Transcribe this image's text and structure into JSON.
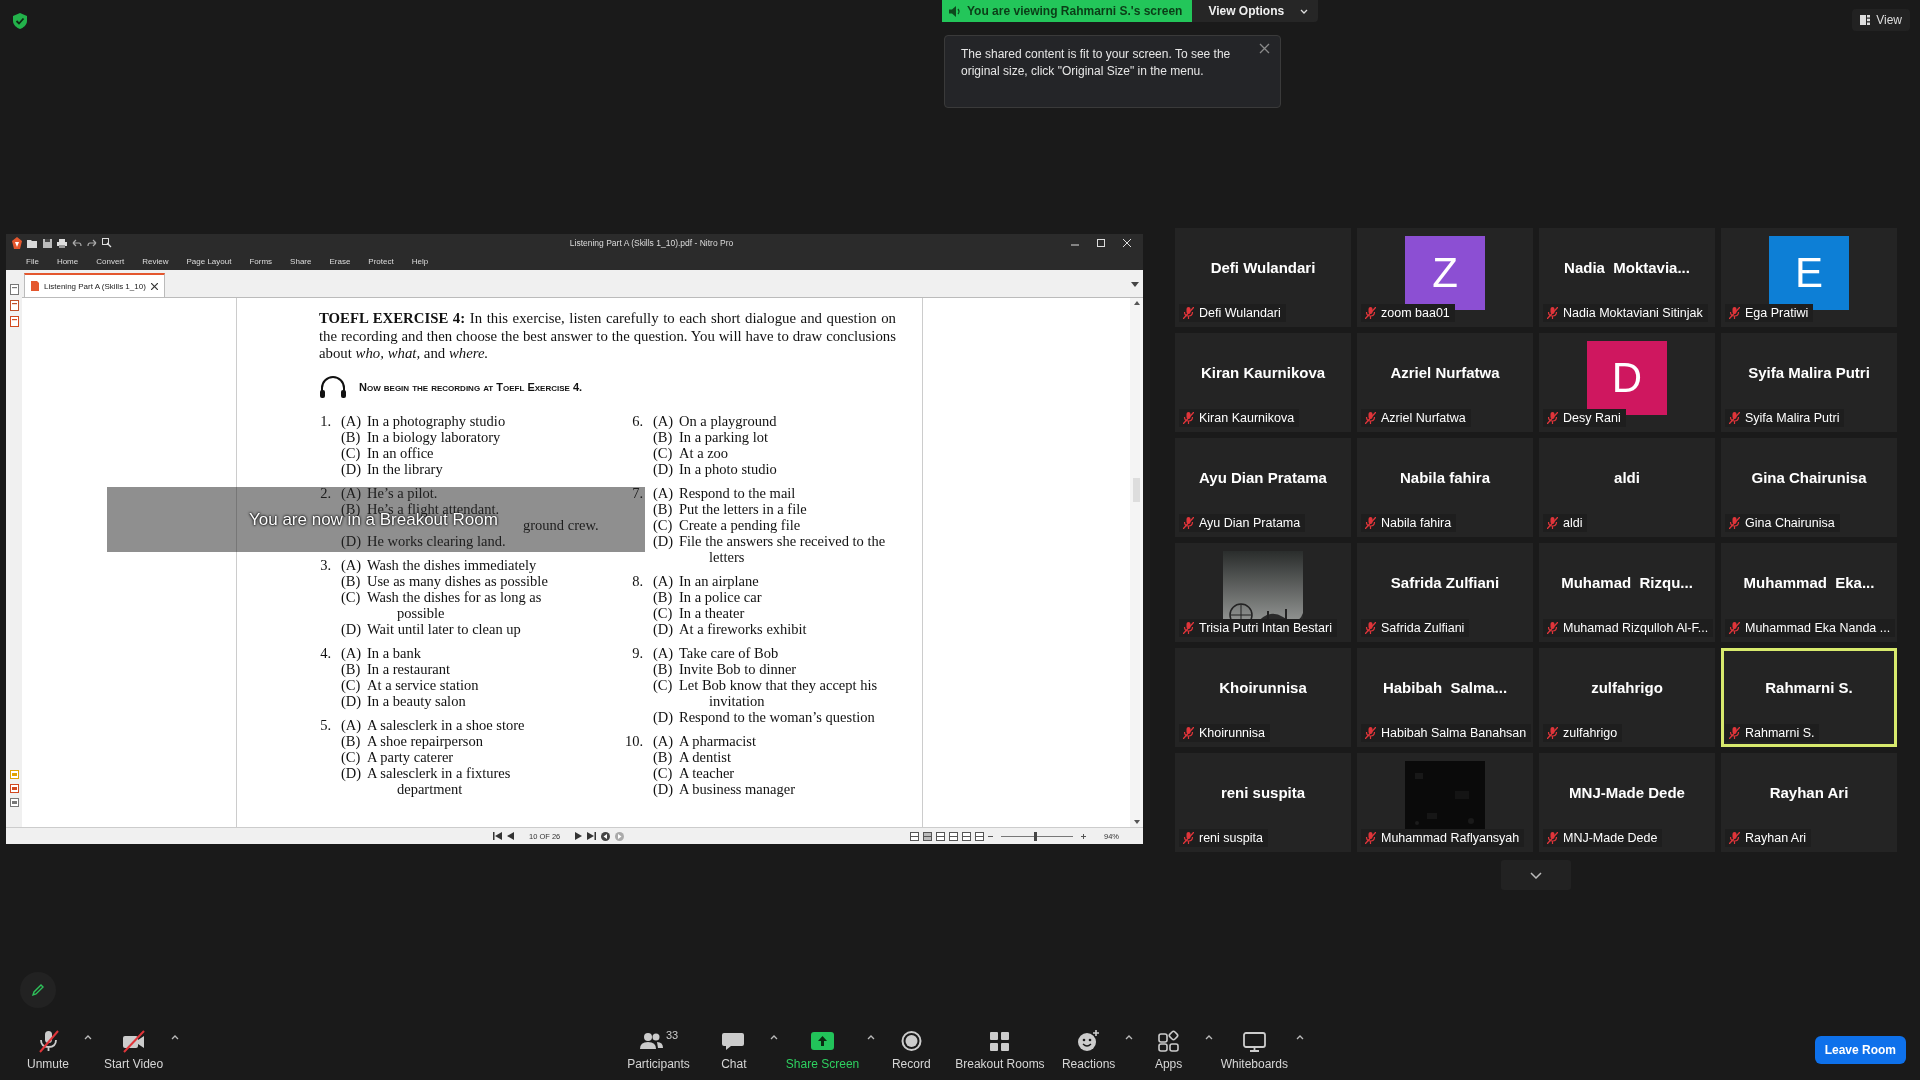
{
  "top_bar": {
    "sharing_banner": "You are viewing Rahmarni S.'s screen",
    "view_options": "View Options",
    "tooltip": "The shared content is fit to your screen. To see the original size, click \"Original Size\" in the menu.",
    "view_button": "View"
  },
  "pdf_window": {
    "title": "Listening Part A (Skills 1_10).pdf - Nitro Pro",
    "menu": [
      "File",
      "Home",
      "Convert",
      "Review",
      "Page Layout",
      "Forms",
      "Share",
      "Erase",
      "Protect",
      "Help"
    ],
    "tabs": [
      {
        "label": "Listening Part A (Skills 1_10)",
        "selected": true
      }
    ],
    "heading": "**TOEFL EXERCISE 4:**  In this exercise, listen carefully to each short dialogue and question on the recording and then choose the best answer to the question. You will have to draw conclusions about *who, what,* and *where.*",
    "instruction": "Now begin the recording at Toefl Exercise 4.",
    "question_columns": [
      [
        {
          "number": "1.",
          "options": [
            {
              "letter": "(A)",
              "text": "In a photography studio"
            },
            {
              "letter": "(B)",
              "text": "In a biology laboratory"
            },
            {
              "letter": "(C)",
              "text": "In an office"
            },
            {
              "letter": "(D)",
              "text": "In the library"
            }
          ]
        },
        {
          "number": "2.",
          "options": [
            {
              "letter": "(A)",
              "text": "He’s a pilot."
            },
            {
              "letter": "(B)",
              "text": "He’s a flight attendant."
            },
            {
              "text": "ground crew."
            },
            {
              "letter": "(D)",
              "text": "He works clearing land."
            }
          ]
        },
        {
          "number": "3.",
          "options": [
            {
              "letter": "(A)",
              "text": "Wash the dishes immediately"
            },
            {
              "letter": "(B)",
              "text": "Use as many dishes as possible"
            },
            {
              "letter": "(C)",
              "text": "Wash the dishes for as long as possible"
            },
            {
              "letter": "(D)",
              "text": "Wait until later to clean up"
            }
          ]
        },
        {
          "number": "4.",
          "options": [
            {
              "letter": "(A)",
              "text": "In a bank"
            },
            {
              "letter": "(B)",
              "text": "In a restaurant"
            },
            {
              "letter": "(C)",
              "text": "At a service station"
            },
            {
              "letter": "(D)",
              "text": "In a beauty salon"
            }
          ]
        },
        {
          "number": "5.",
          "options": [
            {
              "letter": "(A)",
              "text": "A salesclerk in a shoe store"
            },
            {
              "letter": "(B)",
              "text": "A shoe repairperson"
            },
            {
              "letter": "(C)",
              "text": "A party caterer"
            },
            {
              "letter": "(D)",
              "text": "A salesclerk in a fixtures department"
            }
          ]
        }
      ],
      [
        {
          "number": "6.",
          "options": [
            {
              "letter": "(A)",
              "text": "On a playground"
            },
            {
              "letter": "(B)",
              "text": "In a parking lot"
            },
            {
              "letter": "(C)",
              "text": "At a zoo"
            },
            {
              "letter": "(D)",
              "text": "In a photo studio"
            }
          ]
        },
        {
          "number": "7.",
          "options": [
            {
              "letter": "(A)",
              "text": "Respond to the mail"
            },
            {
              "letter": "(B)",
              "text": "Put the letters in a file"
            },
            {
              "letter": "(C)",
              "text": "Create a pending file"
            },
            {
              "letter": "(D)",
              "text": "File the answers she received to the letters"
            }
          ]
        },
        {
          "number": "8.",
          "options": [
            {
              "letter": "(A)",
              "text": "In an airplane"
            },
            {
              "letter": "(B)",
              "text": "In a police car"
            },
            {
              "letter": "(C)",
              "text": "In a theater"
            },
            {
              "letter": "(D)",
              "text": "At a fireworks exhibit"
            }
          ]
        },
        {
          "number": "9.",
          "options": [
            {
              "letter": "(A)",
              "text": "Take care of Bob"
            },
            {
              "letter": "(B)",
              "text": "Invite Bob to dinner"
            },
            {
              "letter": "(C)",
              "text": "Let Bob know that they accept his invitation"
            },
            {
              "letter": "(D)",
              "text": "Respond to the woman’s question"
            }
          ]
        },
        {
          "number": "10.",
          "options": [
            {
              "letter": "(A)",
              "text": "A pharmacist"
            },
            {
              "letter": "(B)",
              "text": "A dentist"
            },
            {
              "letter": "(C)",
              "text": "A teacher"
            },
            {
              "letter": "(D)",
              "text": "A business manager"
            }
          ]
        }
      ]
    ],
    "page_indicator": "10 OF 26",
    "zoom_slider": {
      "level": 0.46
    },
    "zoom": "94%"
  },
  "breakout_notice": "You are now in a Breakout Room",
  "participants": [
    {
      "kind": "name",
      "headline": "Defi Wulandari",
      "label": "Defi Wulandari",
      "muted": true,
      "highlighted": false
    },
    {
      "kind": "avatar",
      "initial": "Z",
      "color": "#8c4fd3",
      "label": "zoom baa01",
      "muted": true,
      "highlighted": false
    },
    {
      "kind": "name",
      "headline": "Nadia  Moktavia...",
      "label": "Nadia Moktaviani Sitinjak",
      "muted": true,
      "highlighted": false
    },
    {
      "kind": "avatar",
      "initial": "E",
      "color": "#0d7fd6",
      "label": "Ega Pratiwi",
      "muted": true,
      "highlighted": false
    },
    {
      "kind": "name",
      "headline": "Kiran Kaurnikova",
      "label": "Kiran Kaurnikova",
      "muted": true,
      "highlighted": false
    },
    {
      "kind": "name",
      "headline": "Azriel Nurfatwa",
      "label": "Azriel Nurfatwa",
      "muted": true,
      "highlighted": false
    },
    {
      "kind": "avatar",
      "initial": "D",
      "color": "#cf175f",
      "label": "Desy Rani",
      "muted": true,
      "highlighted": false
    },
    {
      "kind": "name",
      "headline": "Syifa Malira Putri",
      "label": "Syifa Malira Putri",
      "muted": true,
      "highlighted": false
    },
    {
      "kind": "name",
      "headline": "Ayu Dian Pratama",
      "label": "Ayu Dian Pratama",
      "muted": true,
      "highlighted": false
    },
    {
      "kind": "name",
      "headline": "Nabila fahira",
      "label": "Nabila fahira",
      "muted": true,
      "highlighted": false
    },
    {
      "kind": "name",
      "headline": "aldi",
      "label": "aldi",
      "muted": true,
      "highlighted": false
    },
    {
      "kind": "name",
      "headline": "Gina Chairunisa",
      "label": "Gina Chairunisa",
      "muted": true,
      "highlighted": false
    },
    {
      "kind": "picture",
      "label": "Trisia Putri Intan Bestari",
      "muted": true,
      "highlighted": false
    },
    {
      "kind": "name",
      "headline": "Safrida Zulfiani",
      "label": "Safrida Zulfiani",
      "muted": true,
      "highlighted": false
    },
    {
      "kind": "name",
      "headline": "Muhamad  Rizqu...",
      "label": "Muhamad Rizqulloh Al-F...",
      "muted": true,
      "highlighted": false
    },
    {
      "kind": "name",
      "headline": "Muhammad  Eka...",
      "label": "Muhammad Eka Nanda ...",
      "muted": true,
      "highlighted": false
    },
    {
      "kind": "name",
      "headline": "Khoirunnisa",
      "label": "Khoirunnisa",
      "muted": true,
      "highlighted": false
    },
    {
      "kind": "name",
      "headline": "Habibah  Salma...",
      "label": "Habibah Salma Banahsan",
      "muted": true,
      "highlighted": false
    },
    {
      "kind": "name",
      "headline": "zulfahrigo",
      "label": "zulfahrigo",
      "muted": true,
      "highlighted": false
    },
    {
      "kind": "name",
      "headline": "Rahmarni S.",
      "label": "Rahmarni S.",
      "muted": true,
      "highlighted": true
    },
    {
      "kind": "name",
      "headline": "reni suspita",
      "label": "reni suspita",
      "muted": true,
      "highlighted": false
    },
    {
      "kind": "picture",
      "label": "Muhammad Raflyansyah",
      "muted": true,
      "highlighted": false
    },
    {
      "kind": "name",
      "headline": "MNJ-Made Dede",
      "label": "MNJ-Made Dede",
      "muted": true,
      "highlighted": false
    },
    {
      "kind": "name",
      "headline": "Rayhan Ari",
      "label": "Rayhan Ari",
      "muted": true,
      "highlighted": false
    }
  ],
  "toolbar": {
    "left": [
      {
        "kind": "mic",
        "label": "Unmute",
        "caret": true
      },
      {
        "kind": "video",
        "label": "Start Video",
        "caret": true
      }
    ],
    "center": [
      {
        "kind": "participants",
        "label": "Participants",
        "count": "33",
        "caret": false
      },
      {
        "kind": "chat",
        "label": "Chat",
        "caret": true
      },
      {
        "kind": "share",
        "label": "Share Screen",
        "caret": true
      },
      {
        "kind": "record",
        "label": "Record",
        "caret": false
      },
      {
        "kind": "breakout",
        "label": "Breakout Rooms",
        "caret": false
      },
      {
        "kind": "reactions",
        "label": "Reactions",
        "caret": true
      },
      {
        "kind": "apps",
        "label": "Apps",
        "caret": true
      },
      {
        "kind": "whiteboard",
        "label": "Whiteboards",
        "caret": true
      }
    ],
    "leave_button": "Leave Room"
  }
}
